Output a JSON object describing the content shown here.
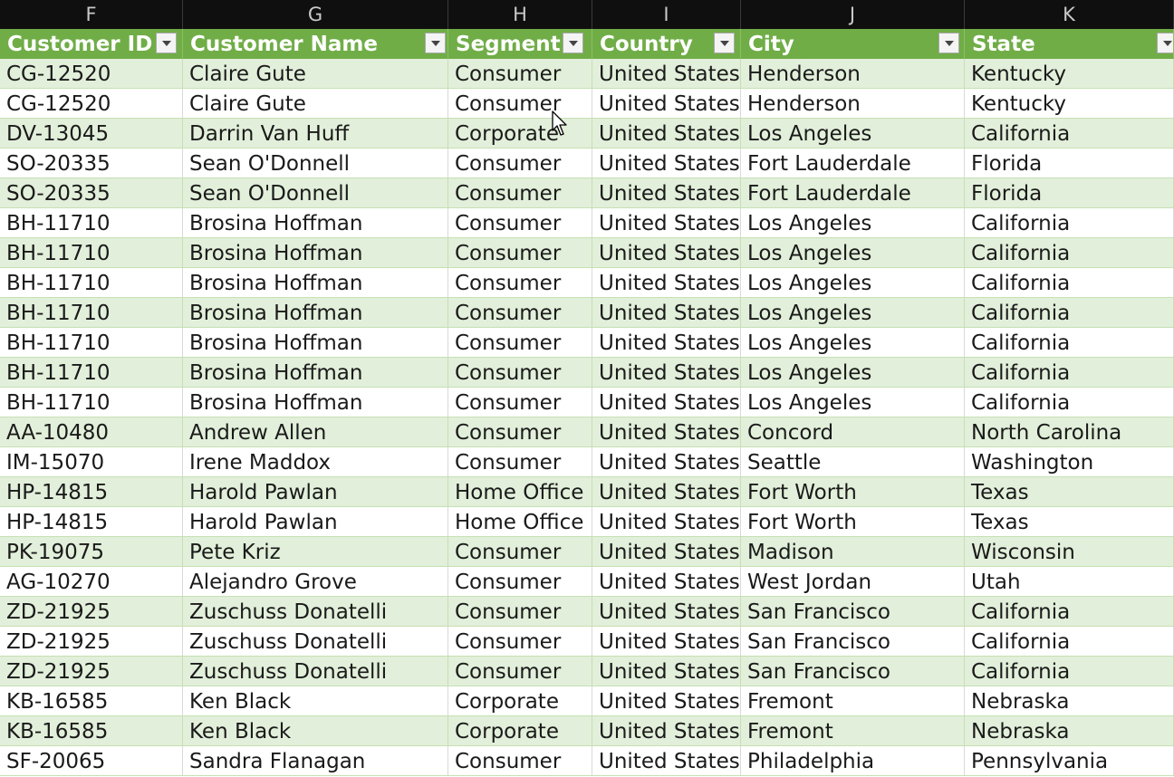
{
  "columns": [
    {
      "letter": "F",
      "header": "Customer ID"
    },
    {
      "letter": "G",
      "header": "Customer Name"
    },
    {
      "letter": "H",
      "header": "Segment"
    },
    {
      "letter": "I",
      "header": "Country"
    },
    {
      "letter": "J",
      "header": "City"
    },
    {
      "letter": "K",
      "header": "State"
    }
  ],
  "rows": [
    [
      "CG-12520",
      "Claire Gute",
      "Consumer",
      "United States",
      "Henderson",
      "Kentucky"
    ],
    [
      "CG-12520",
      "Claire Gute",
      "Consumer",
      "United States",
      "Henderson",
      "Kentucky"
    ],
    [
      "DV-13045",
      "Darrin Van Huff",
      "Corporate",
      "United States",
      "Los Angeles",
      "California"
    ],
    [
      "SO-20335",
      "Sean O'Donnell",
      "Consumer",
      "United States",
      "Fort Lauderdale",
      "Florida"
    ],
    [
      "SO-20335",
      "Sean O'Donnell",
      "Consumer",
      "United States",
      "Fort Lauderdale",
      "Florida"
    ],
    [
      "BH-11710",
      "Brosina Hoffman",
      "Consumer",
      "United States",
      "Los Angeles",
      "California"
    ],
    [
      "BH-11710",
      "Brosina Hoffman",
      "Consumer",
      "United States",
      "Los Angeles",
      "California"
    ],
    [
      "BH-11710",
      "Brosina Hoffman",
      "Consumer",
      "United States",
      "Los Angeles",
      "California"
    ],
    [
      "BH-11710",
      "Brosina Hoffman",
      "Consumer",
      "United States",
      "Los Angeles",
      "California"
    ],
    [
      "BH-11710",
      "Brosina Hoffman",
      "Consumer",
      "United States",
      "Los Angeles",
      "California"
    ],
    [
      "BH-11710",
      "Brosina Hoffman",
      "Consumer",
      "United States",
      "Los Angeles",
      "California"
    ],
    [
      "BH-11710",
      "Brosina Hoffman",
      "Consumer",
      "United States",
      "Los Angeles",
      "California"
    ],
    [
      "AA-10480",
      "Andrew Allen",
      "Consumer",
      "United States",
      "Concord",
      "North Carolina"
    ],
    [
      "IM-15070",
      "Irene Maddox",
      "Consumer",
      "United States",
      "Seattle",
      "Washington"
    ],
    [
      "HP-14815",
      "Harold Pawlan",
      "Home Office",
      "United States",
      "Fort Worth",
      "Texas"
    ],
    [
      "HP-14815",
      "Harold Pawlan",
      "Home Office",
      "United States",
      "Fort Worth",
      "Texas"
    ],
    [
      "PK-19075",
      "Pete Kriz",
      "Consumer",
      "United States",
      "Madison",
      "Wisconsin"
    ],
    [
      "AG-10270",
      "Alejandro Grove",
      "Consumer",
      "United States",
      "West Jordan",
      "Utah"
    ],
    [
      "ZD-21925",
      "Zuschuss Donatelli",
      "Consumer",
      "United States",
      "San Francisco",
      "California"
    ],
    [
      "ZD-21925",
      "Zuschuss Donatelli",
      "Consumer",
      "United States",
      "San Francisco",
      "California"
    ],
    [
      "ZD-21925",
      "Zuschuss Donatelli",
      "Consumer",
      "United States",
      "San Francisco",
      "California"
    ],
    [
      "KB-16585",
      "Ken Black",
      "Corporate",
      "United States",
      "Fremont",
      "Nebraska"
    ],
    [
      "KB-16585",
      "Ken Black",
      "Corporate",
      "United States",
      "Fremont",
      "Nebraska"
    ],
    [
      "SF-20065",
      "Sandra Flanagan",
      "Consumer",
      "United States",
      "Philadelphia",
      "Pennsylvania"
    ]
  ],
  "colors": {
    "header_fill": "#70ad47",
    "band_fill": "#e2efda",
    "column_letter_bar": "#0f0f0f"
  },
  "icons": {
    "filter": "filter-dropdown-icon",
    "cursor": "mouse-pointer-icon"
  }
}
